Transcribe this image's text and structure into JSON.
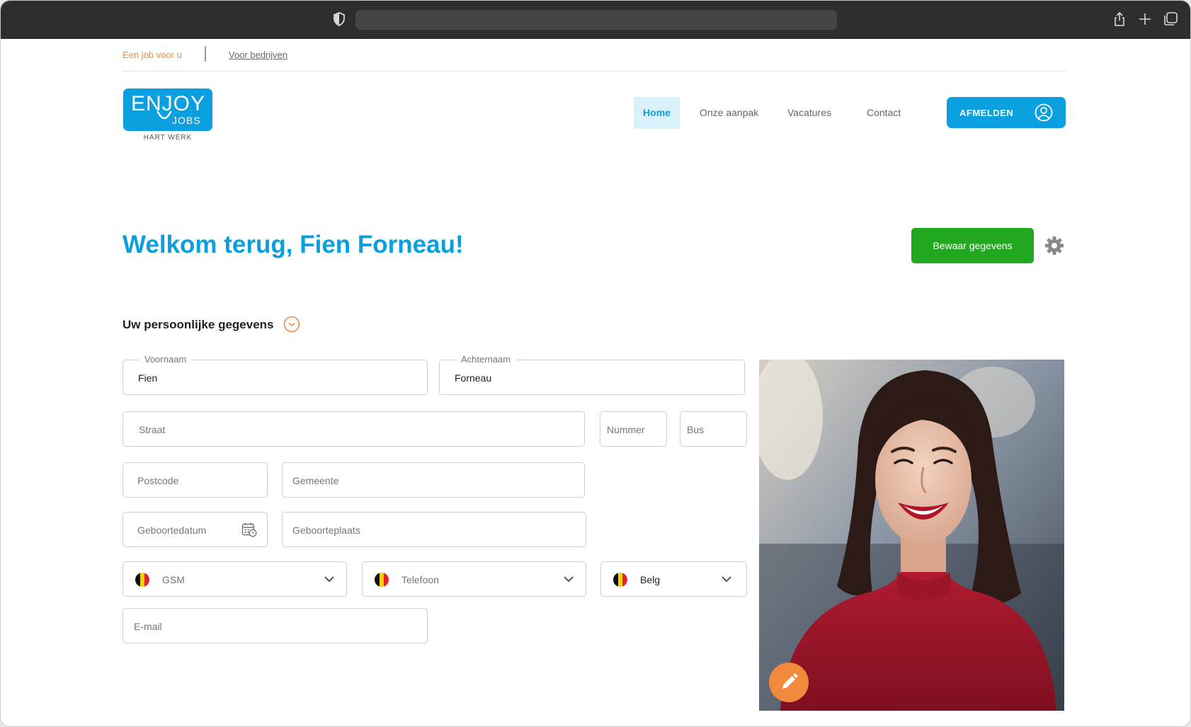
{
  "colors": {
    "brand_blue": "#0aa0df",
    "accent_orange": "#f28a3c",
    "save_green": "#22a81f",
    "browser_chrome": "#2e2e2e"
  },
  "browser": {
    "icons": [
      "shield-icon",
      "share-icon",
      "new-tab-icon",
      "tabs-overview-icon"
    ]
  },
  "toplinks": {
    "job_for_you": "Een job voor u",
    "for_companies": "Voor bedrijven"
  },
  "logo": {
    "enjoy": "ENJOY",
    "jobs": "JOBS",
    "tagline": "HART WERK"
  },
  "nav": {
    "home": "Home",
    "approach": "Onze aanpak",
    "vacancies": "Vacatures",
    "contact": "Contact",
    "logout": "AFMELDEN"
  },
  "page": {
    "welcome": "Welkom terug, Fien Forneau!",
    "save_button": "Bewaar gegevens",
    "section_title": "Uw persoonlijke gegevens"
  },
  "form": {
    "firstname": {
      "label": "Voornaam",
      "value": "Fien"
    },
    "lastname": {
      "label": "Achternaam",
      "value": "Forneau"
    },
    "street": {
      "placeholder": "Straat"
    },
    "number": {
      "placeholder": "Nummer"
    },
    "bus": {
      "placeholder": "Bus"
    },
    "postcode": {
      "placeholder": "Postcode"
    },
    "municipality": {
      "placeholder": "Gemeente"
    },
    "birthdate": {
      "placeholder": "Geboortedatum"
    },
    "birthplace": {
      "placeholder": "Geboorteplaats"
    },
    "mobile": {
      "placeholder": "GSM"
    },
    "phone": {
      "placeholder": "Telefoon"
    },
    "nationality": {
      "value": "Belg"
    },
    "email": {
      "placeholder": "E-mail"
    }
  }
}
